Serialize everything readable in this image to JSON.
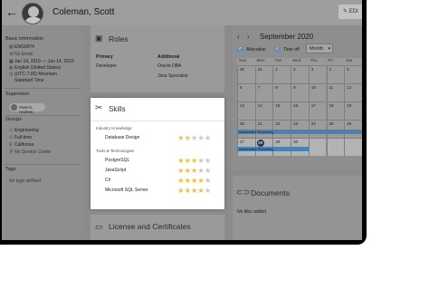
{
  "header": {
    "name": "Coleman, Scott",
    "edit_label": "EDI"
  },
  "sidebar": {
    "basic_info_title": "Basic information",
    "basic_info": [
      {
        "icon": "id-icon",
        "glyph": "▤",
        "text": "ENG0074"
      },
      {
        "icon": "email-icon",
        "glyph": "✉",
        "text": "No Email",
        "muted": true
      },
      {
        "icon": "calendar-icon",
        "glyph": "▦",
        "text": "Jan 14, 2019 — Jan 14, 2023"
      },
      {
        "icon": "language-icon",
        "glyph": "◍",
        "text": "English (United States)"
      },
      {
        "icon": "clock-icon",
        "glyph": "◷",
        "text": "(UTC-7:00) Mountain"
      },
      {
        "icon": "",
        "glyph": "",
        "text": "Standard Time"
      }
    ],
    "supervisor_title": "Supervisor",
    "supervisor": "Owens, Andrew",
    "groups_title": "Groups",
    "groups": [
      {
        "icon": "people-icon",
        "glyph": "⚇",
        "text": "Engineering"
      },
      {
        "icon": "people-icon",
        "glyph": "⚇",
        "text": "Full-time"
      },
      {
        "icon": "location-icon",
        "glyph": "⚲",
        "text": "California"
      },
      {
        "icon": "location-icon",
        "glyph": "⚲",
        "text": "No Service Center",
        "muted": true
      }
    ],
    "tags_title": "Tags",
    "tags_empty": "No tags defined"
  },
  "roles": {
    "title": "Roles",
    "primary_header": "Primary",
    "primary": [
      "Developer"
    ],
    "additional_header": "Additional",
    "additional": [
      "Oracle DBA",
      "Java Specialist"
    ]
  },
  "skills": {
    "title": "Skills",
    "categories": [
      {
        "name": "Industry Knowledge",
        "items": [
          {
            "name": "Database Design",
            "rating": 2
          }
        ]
      },
      {
        "name": "Tools & Technologies",
        "items": [
          {
            "name": "PostgreSQL",
            "rating": 3
          },
          {
            "name": "JavaScript",
            "rating": 3
          },
          {
            "name": "C#",
            "rating": 4
          },
          {
            "name": "Microsoft SQL Server",
            "rating": 4
          }
        ]
      }
    ],
    "max_rating": 5
  },
  "license": {
    "title": "License and Certificates"
  },
  "calendar": {
    "month": "September 2020",
    "allocation_label": "Allocation",
    "timeoff_label": "Time off",
    "view_selected": "Month",
    "dow": [
      "Sun",
      "Mon",
      "Tue",
      "Wed",
      "Thu",
      "Fri",
      "Sat"
    ],
    "weeks": [
      [
        "30",
        "31",
        "1",
        "2",
        "3",
        "4",
        "5"
      ],
      [
        "6",
        "7",
        "8",
        "9",
        "10",
        "11",
        "12"
      ],
      [
        "13",
        "14",
        "15",
        "16",
        "17",
        "18",
        "19"
      ],
      [
        "20",
        "21",
        "22",
        "23",
        "24",
        "25",
        "26"
      ],
      [
        "27",
        "28",
        "29",
        "30",
        "",
        "",
        ""
      ]
    ],
    "today": "28",
    "event_label": "Automated Reporting"
  },
  "documents": {
    "title": "Documents",
    "empty": "No files added"
  },
  "colors": {
    "accent": "#4a82b4",
    "star": "#e9c34a",
    "star_off": "#c9c9c9"
  }
}
